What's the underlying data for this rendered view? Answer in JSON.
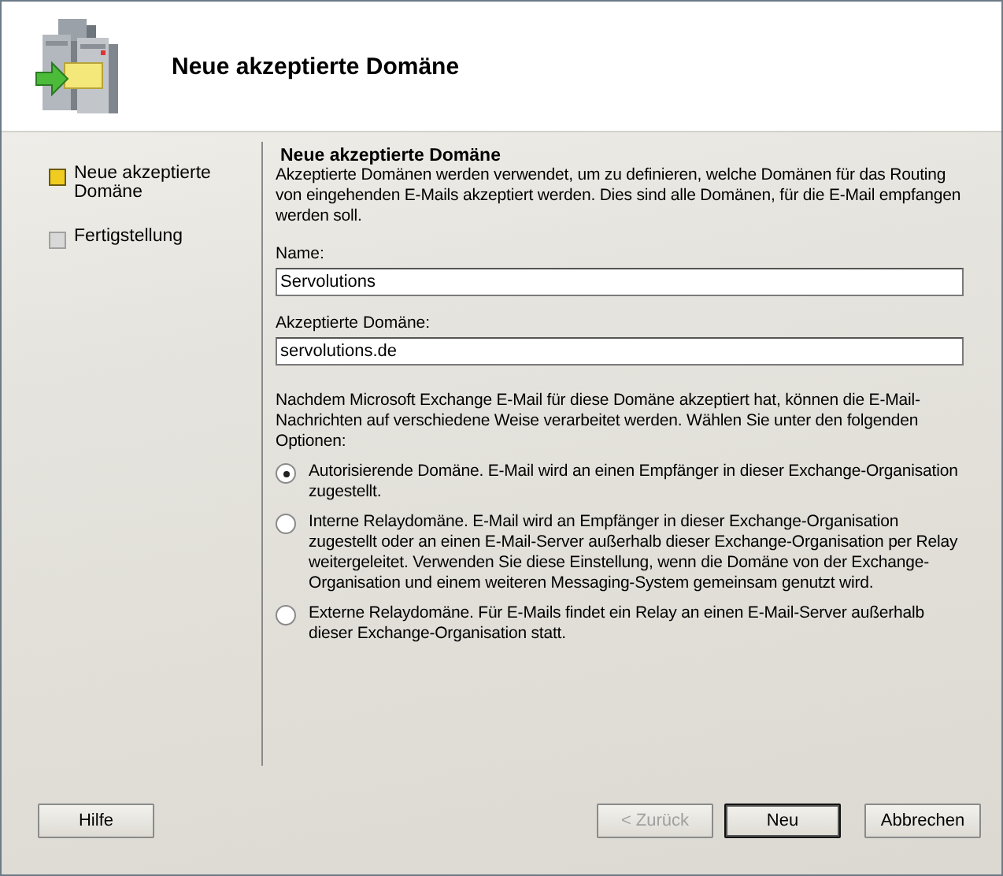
{
  "header": {
    "title": "Neue akzeptierte Domäne"
  },
  "steps": [
    {
      "label": "Neue akzeptierte Domäne",
      "selected": true
    },
    {
      "label": "Fertigstellung",
      "selected": false
    }
  ],
  "content": {
    "heading": "Neue akzeptierte Domäne",
    "description": "Akzeptierte Domänen werden verwendet, um zu definieren, welche Domänen für das Routing von eingehenden E-Mails akzeptiert werden. Dies sind alle Domänen, für die E-Mail empfangen werden soll.",
    "fields": [
      {
        "label": "Name:",
        "value": "Servolutions"
      },
      {
        "label": "Akzeptierte Domäne:",
        "value": "servolutions.de"
      }
    ],
    "options_intro": "Nachdem Microsoft Exchange E-Mail für diese Domäne akzeptiert hat, können die E-Mail-Nachrichten auf verschiedene Weise verarbeitet werden. Wählen Sie unter den folgenden Optionen:",
    "options": [
      {
        "label": "Autorisierende Domäne. E-Mail wird an einen Empfänger in dieser Exchange-Organisation zugestellt.",
        "selected": true
      },
      {
        "label": "Interne Relaydomäne. E-Mail wird an Empfänger in dieser Exchange-Organisation zugestellt oder an einen E-Mail-Server außerhalb dieser Exchange-Organisation per Relay weitergeleitet. Verwenden Sie diese Einstellung, wenn die Domäne von der Exchange-Organisation und einem weiteren Messaging-System gemeinsam genutzt wird.",
        "selected": false
      },
      {
        "label": "Externe Relaydomäne. Für E-Mails findet ein Relay an einen E-Mail-Server außerhalb dieser Exchange-Organisation statt.",
        "selected": false
      }
    ]
  },
  "buttons": {
    "help": "Hilfe",
    "nav": [
      {
        "label": "< Zurück",
        "disabled": true,
        "default": false
      },
      {
        "label": "Neu",
        "disabled": false,
        "default": true
      },
      {
        "label": "Abbrechen",
        "disabled": false,
        "default": false
      }
    ]
  }
}
